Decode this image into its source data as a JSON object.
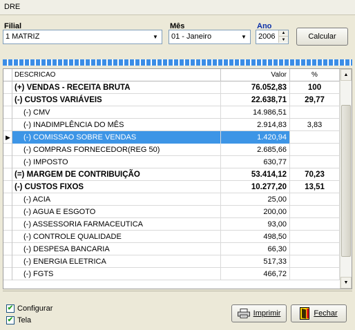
{
  "window": {
    "title": "DRE"
  },
  "filters": {
    "filial_label": "Filial",
    "filial_value": "1 MATRIZ",
    "mes_label": "Mês",
    "mes_value": "01 - Janeiro",
    "ano_label": "Ano",
    "ano_value": "2006",
    "calcular_label": "Calcular"
  },
  "grid": {
    "columns": [
      "DESCRICAO",
      "Valor",
      "%"
    ],
    "rows": [
      {
        "desc": "(+) VENDAS - RECEITA BRUTA",
        "valor": "76.052,83",
        "pct": "100",
        "bold": true
      },
      {
        "desc": "(-) CUSTOS VARIÁVEIS",
        "valor": "22.638,71",
        "pct": "29,77",
        "bold": true
      },
      {
        "desc": "(-) CMV",
        "valor": "14.986,51",
        "pct": ""
      },
      {
        "desc": "(-) INADIMPLÊNCIA DO MÊS",
        "valor": "2.914,83",
        "pct": "3,83"
      },
      {
        "desc": "(-) COMISSAO SOBRE VENDAS",
        "valor": "1.420,94",
        "pct": "",
        "selected": true
      },
      {
        "desc": "(-) COMPRAS FORNECEDOR(REG 50)",
        "valor": "2.685,66",
        "pct": ""
      },
      {
        "desc": "(-) IMPOSTO",
        "valor": "630,77",
        "pct": ""
      },
      {
        "desc": "(=) MARGEM DE CONTRIBUIÇÃO",
        "valor": "53.414,12",
        "pct": "70,23",
        "bold": true
      },
      {
        "desc": "(-) CUSTOS FIXOS",
        "valor": "10.277,20",
        "pct": "13,51",
        "bold": true
      },
      {
        "desc": "(-) ACIA",
        "valor": "25,00",
        "pct": ""
      },
      {
        "desc": "(-) AGUA E ESGOTO",
        "valor": "200,00",
        "pct": ""
      },
      {
        "desc": "(-) ASSESSORIA FARMACEUTICA",
        "valor": "93,00",
        "pct": ""
      },
      {
        "desc": "(-) CONTROLE QUALIDADE",
        "valor": "498,50",
        "pct": ""
      },
      {
        "desc": "(-) DESPESA BANCARIA",
        "valor": "66,30",
        "pct": ""
      },
      {
        "desc": "(-) ENERGIA ELETRICA",
        "valor": "517,33",
        "pct": ""
      },
      {
        "desc": "(-) FGTS",
        "valor": "466,72",
        "pct": ""
      }
    ]
  },
  "footer": {
    "configurar_label": "Configurar",
    "configurar_checked": true,
    "tela_label": "Tela",
    "tela_checked": true,
    "imprimir_label": "Imprimir",
    "fechar_label": "Fechar"
  }
}
